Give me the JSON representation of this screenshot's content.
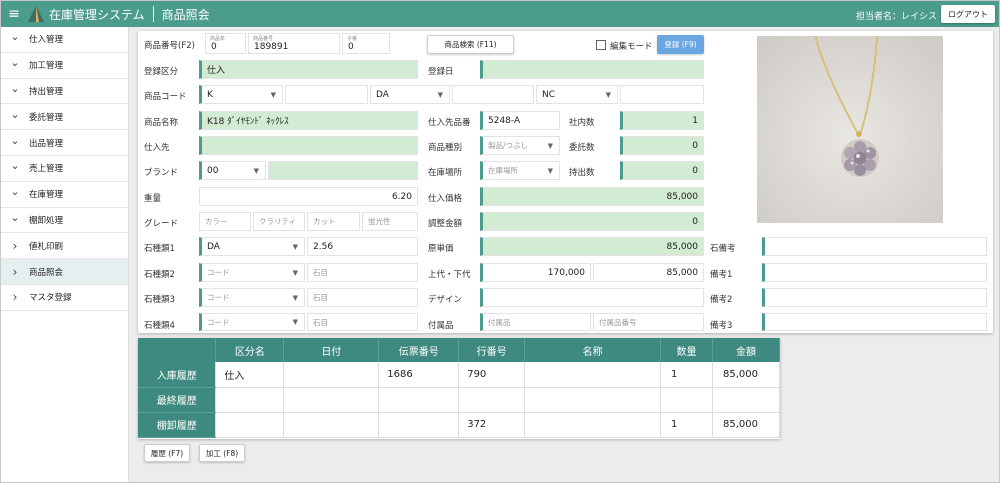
{
  "header": {
    "app_title": "在庫管理システム",
    "page_title": "商品照会",
    "user_label": "担当者名：レイシス",
    "logout_label": "ログアウト"
  },
  "sidebar": {
    "items": [
      {
        "label": "仕入管理",
        "expanded": true
      },
      {
        "label": "加工管理",
        "expanded": true
      },
      {
        "label": "持出管理",
        "expanded": true
      },
      {
        "label": "委託管理",
        "expanded": true
      },
      {
        "label": "出品管理",
        "expanded": true
      },
      {
        "label": "売上管理",
        "expanded": true
      },
      {
        "label": "在庫管理",
        "expanded": true
      },
      {
        "label": "棚卸処理",
        "expanded": true
      },
      {
        "label": "値札印刷",
        "expanded": false
      },
      {
        "label": "商品照会",
        "expanded": false,
        "active": true
      },
      {
        "label": "マスタ登録",
        "expanded": false
      }
    ]
  },
  "form": {
    "product_no_label": "商品番号(F2)",
    "product_no_parts": [
      {
        "caption": "商品年",
        "value": "0"
      },
      {
        "caption": "商品番号",
        "value": "189891"
      },
      {
        "caption": "子番",
        "value": "0"
      }
    ],
    "search_button": "商品検索 (F11)",
    "edit_mode_label": "編集モード",
    "register_button": "登録 (F9)",
    "reg_type_label": "登録区分",
    "reg_type_value": "仕入",
    "reg_date_label": "登録日",
    "reg_date_value": "",
    "code_label": "商品コード",
    "code_values": [
      "K",
      "DA",
      "NC"
    ],
    "name_label": "商品名称",
    "name_value": "K18 ﾀﾞｲﾔﾓﾝﾄﾞ ﾈｯｸﾚｽ",
    "supplier_label": "仕入先",
    "supplier_value": "",
    "brand_label": "ブランド",
    "brand_value": "00",
    "weight_label": "重量",
    "weight_value": "6.20",
    "grade_label": "グレード",
    "grade_placeholders": [
      "カラー",
      "クラリティ",
      "カット",
      "蛍光性"
    ],
    "stone1_label": "石種類1",
    "stone1_value": "DA",
    "stone1_weight": "2.56",
    "stone2_label": "石種類2",
    "stone3_label": "石種類3",
    "stone4_label": "石種類4",
    "stone_code_placeholder": "コード",
    "stone_weight_placeholder": "石目",
    "supplier_no_label": "仕入先品番",
    "supplier_no_value": "5248-A",
    "category_label": "商品種別",
    "category_placeholder": "製品/つぶし",
    "location_label": "在庫場所",
    "location_placeholder": "在庫場所",
    "purchase_price_label": "仕入価格",
    "purchase_price_value": "85,000",
    "adjust_label": "調整金額",
    "adjust_value": "0",
    "cost_label": "原単価",
    "cost_value": "85,000",
    "upper_lower_label": "上代・下代",
    "upper_value": "170,000",
    "lower_value": "85,000",
    "design_label": "デザイン",
    "accessory_label": "付属品",
    "accessory_placeholder": "付属品",
    "accessory_no_placeholder": "付属品番号",
    "in_house_label": "社内数",
    "in_house_value": "1",
    "consign_label": "委託数",
    "consign_value": "0",
    "out_label": "持出数",
    "out_value": "0",
    "stone_note_label": "石備考",
    "note1_label": "備考1",
    "note2_label": "備考2",
    "note3_label": "備考3"
  },
  "history": {
    "columns": [
      "区分名",
      "日付",
      "伝票番号",
      "行番号",
      "名称",
      "数量",
      "金額"
    ],
    "rows": [
      {
        "header": "入庫履歴",
        "cells": [
          "仕入",
          "",
          "1686",
          "790",
          "",
          "1",
          "85,000"
        ]
      },
      {
        "header": "最終履歴",
        "cells": [
          "",
          "",
          "",
          "",
          "",
          "",
          ""
        ]
      },
      {
        "header": "棚卸履歴",
        "cells": [
          "",
          "",
          "",
          "372",
          "",
          "1",
          "85,000"
        ]
      }
    ]
  },
  "footer_buttons": {
    "history": "履歴 (F7)",
    "process": "加工 (F8)"
  },
  "icons": {
    "menu": "hamburger-icon",
    "logo": "triangle-logo-icon",
    "photo": "product-photo-necklace"
  },
  "colors": {
    "header": "#4c9c8e",
    "table_header": "#3f8a80",
    "highlight_field": "#d3ebd2",
    "register_button": "#6aa7e0"
  }
}
